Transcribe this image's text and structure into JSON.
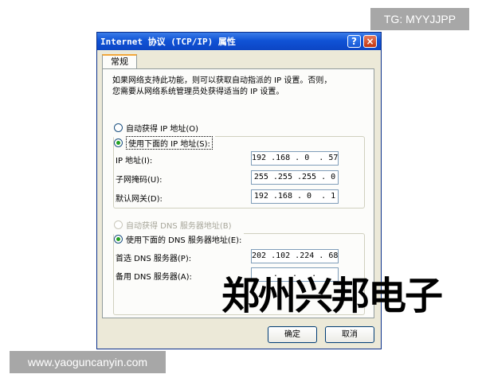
{
  "watermark_top": "TG: MYYJJPP",
  "watermark_bottom": "www.yaoguncanyin.com",
  "stamp_text": "郑州兴邦电子",
  "dialog": {
    "title": "Internet 协议 (TCP/IP) 属性",
    "help_glyph": "?",
    "close_glyph": "×",
    "tab_label": "常规",
    "description_line1": "如果网络支持此功能，则可以获取自动指派的 IP 设置。否则，",
    "description_line2": "您需要从网络系统管理员处获得适当的 IP 设置。",
    "ip": {
      "auto_label": "自动获得 IP 地址(O)",
      "manual_label": "使用下面的 IP 地址(S):",
      "fields": [
        {
          "label": "IP 地址(I):",
          "value": "192 .168 . 0  . 57"
        },
        {
          "label": "子网掩码(U):",
          "value": "255 .255 .255 . 0"
        },
        {
          "label": "默认网关(D):",
          "value": "192 .168 . 0  . 1"
        }
      ]
    },
    "dns": {
      "auto_label": "自动获得 DNS 服务器地址(B)",
      "manual_label": "使用下面的 DNS 服务器地址(E):",
      "fields": [
        {
          "label": "首选 DNS 服务器(P):",
          "value": "202 .102 .224 . 68"
        },
        {
          "label": "备用 DNS 服务器(A):",
          "value": "  .   .   .  "
        }
      ]
    },
    "ok_label": "确定",
    "cancel_label": "取消"
  }
}
